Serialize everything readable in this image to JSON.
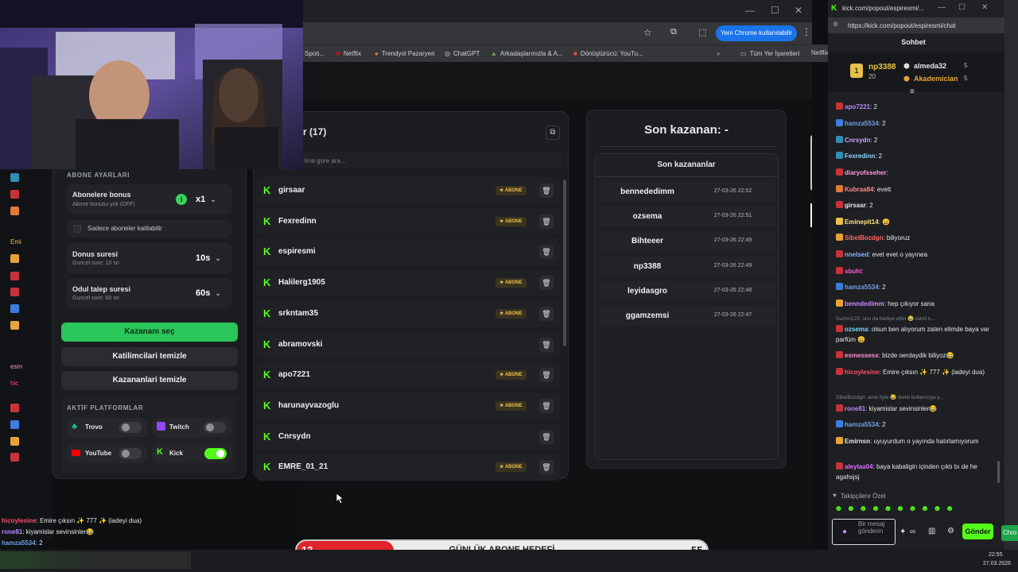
{
  "browser": {
    "bookmarks": [
      "Spoti...",
      "Netflix",
      "Trendyol Pazaryeri",
      "ChatGPT",
      "Arkadaşlarınızla & A...",
      "Dönüştürücü: YouTu...",
      "Tüm Yer İşaretleri",
      "Netflix"
    ],
    "profile_button": "Yeni Chrome kullanılabilir",
    "window_controls": [
      "—",
      "☐",
      "✕"
    ]
  },
  "settings": {
    "section_title": "ABONE AYARLARI",
    "sub_bonus_label": "Abonelere bonus",
    "sub_bonus_desc": "Abone bonusu yok (OFF)",
    "sub_bonus_value": "x1",
    "sub_only_label": "Sadece aboneler katilabilir",
    "bonus_time_label": "Donus suresi",
    "bonus_time_desc": "Guncel sure: 10 sn",
    "bonus_time_value": "10s",
    "claim_time_label": "Odul talep suresi",
    "claim_time_desc": "Guncel sure: 60 sn",
    "claim_time_value": "60s",
    "pick_winner": "Kazananı seç",
    "clear_participants": "Katilimcilari temizle",
    "clear_winners": "Kazananlari temizle",
    "platforms_title": "AKTİF PLATFORMLAR",
    "platforms": [
      {
        "name": "Trovo",
        "on": false
      },
      {
        "name": "Twitch",
        "on": false
      },
      {
        "name": "YouTube",
        "on": false
      },
      {
        "name": "Kick",
        "on": true
      }
    ]
  },
  "participants": {
    "title": "r (17)",
    "search_placeholder": "lına gore ara...",
    "badge_label": "ABONE",
    "rows": [
      {
        "name": "girsaar",
        "sub": true
      },
      {
        "name": "Fexredinn",
        "sub": true
      },
      {
        "name": "espiresmi",
        "sub": false
      },
      {
        "name": "Halilerg1905",
        "sub": true
      },
      {
        "name": "srkntam35",
        "sub": true
      },
      {
        "name": "abramovski",
        "sub": false
      },
      {
        "name": "apo7221",
        "sub": true
      },
      {
        "name": "harunayvazoglu",
        "sub": true
      },
      {
        "name": "Cnrsydn",
        "sub": false
      },
      {
        "name": "EMRE_01_21",
        "sub": true
      }
    ]
  },
  "winners": {
    "last_winner": "Son kazanan: -",
    "list_title": "Son kazananlar",
    "rows": [
      {
        "name": "bennededimm",
        "time": "27-03-26 22:52"
      },
      {
        "name": "ozsema",
        "time": "27-03-26 22:51"
      },
      {
        "name": "Bihteeer",
        "time": "27-03-26 22:49"
      },
      {
        "name": "np3388",
        "time": "27-03-26 22:49"
      },
      {
        "name": "leyidasgro",
        "time": "27-03-26 22:48"
      },
      {
        "name": "ggamzemsi",
        "time": "27-03-26 22:47"
      }
    ]
  },
  "chat": {
    "tab_title": "kick.com/popout/espiresmi/...",
    "url": "https://kick.com/popout/espiresmi/chat",
    "header": "Sohbet",
    "pinned": [
      {
        "user": "np3388",
        "count": "20"
      },
      {
        "user": "almeda32",
        "count": "5"
      },
      {
        "user": "Akademician",
        "count": "5"
      }
    ],
    "messages": [
      {
        "user": "apo7221",
        "text": ": 2",
        "color": "#b58aff"
      },
      {
        "user": "hamza5534",
        "text": ": 2",
        "color": "#6f9fe8"
      },
      {
        "user": "Cnrsydn",
        "text": ": 2",
        "color": "#c9a3ff"
      },
      {
        "user": "Fexredinn",
        "text": ": 2",
        "color": "#8ad6ff"
      },
      {
        "user": "diaryofsseher",
        "text": ":",
        "color": "#ff9ae3"
      },
      {
        "user": "Kubraa84",
        "text": ": evett",
        "color": "#ff8a8a"
      },
      {
        "user": "girsaar",
        "text": ": 2",
        "color": "#e8e8e8"
      },
      {
        "user": "Emineplt14",
        "text": ": 😄",
        "color": "#ffe07a"
      },
      {
        "user": "SibelBozdgn",
        "text": ": biliyoruz",
        "color": "#ff6464"
      },
      {
        "user": "nnelsed",
        "text": ": evet evet o yayınea",
        "color": "#8ab4ff"
      },
      {
        "user": "sbuhi",
        "text": ":",
        "color": "#ff5ad0"
      },
      {
        "user": "hamza5534",
        "text": ": 2",
        "color": "#6f9fe8"
      },
      {
        "user": "benndedimm",
        "text": ": hep çıkıyor sana",
        "color": "#c98aff"
      },
      {
        "user": "ozsema",
        "text": ": olsun ben alıyorum zaten elimde baya var parfüm 😄",
        "color": "#78d8ff"
      },
      {
        "user": "esmessess",
        "text": ": bizde oerdaydik biliyoz😂",
        "color": "#ff8fd1"
      },
      {
        "user": "hicoylesine",
        "text": ": Emire çıksın ✨ 777 ✨ (iadeyi dua)",
        "color": "#ff4d6d"
      },
      {
        "user": "rone81",
        "text": ": kiyamislar sevinsinler😂",
        "color": "#b58aff"
      },
      {
        "user": "hamza5534",
        "text": ": 2",
        "color": "#6f9fe8"
      },
      {
        "user": "Emirnsn",
        "text": ": uyuyurdum o yayında hatırlamıyorum",
        "color": "#e8e8e8"
      },
      {
        "user": "aleylaa04",
        "text": ": baya kabaligin içinden çıktı bı de he agahsjsj",
        "color": "#e06cff"
      }
    ],
    "reply_1": "Summ123: onu da hediye ettin 😂 isimli k...",
    "reply_2": "SibelBozdgn: ama öyle 😂 Isimli kullanıcıya y...",
    "followers_only": "Takipçilere Özel",
    "input_placeholder": "Bir mesaj gönderin",
    "send_button": "Gönder",
    "right_edge_text": "Chro"
  },
  "overlay": {
    "left_chat": [
      {
        "user": "hicoylesine",
        "text": ": Emire çıksın ✨ 777 ✨ (iadeyi dua)"
      },
      {
        "user": "rone81",
        "text": ": kiyamislar sevinsinler😂"
      },
      {
        "user": "hamza5534",
        "text": ": 2"
      }
    ],
    "goal_current": "13",
    "goal_title": "GÜNLÜK ABONE HEDEFİ",
    "goal_target": "55",
    "goal_progress": 0.236,
    "side_text_1": "Emi",
    "side_text_2": "esm",
    "side_text_3": "hic"
  },
  "taskbar": {
    "time": "22:55",
    "date": "27.03.2026"
  },
  "colors": {
    "kick_green": "#53fc18",
    "goal_red": "#e0242c",
    "gold": "#e8c04a"
  }
}
